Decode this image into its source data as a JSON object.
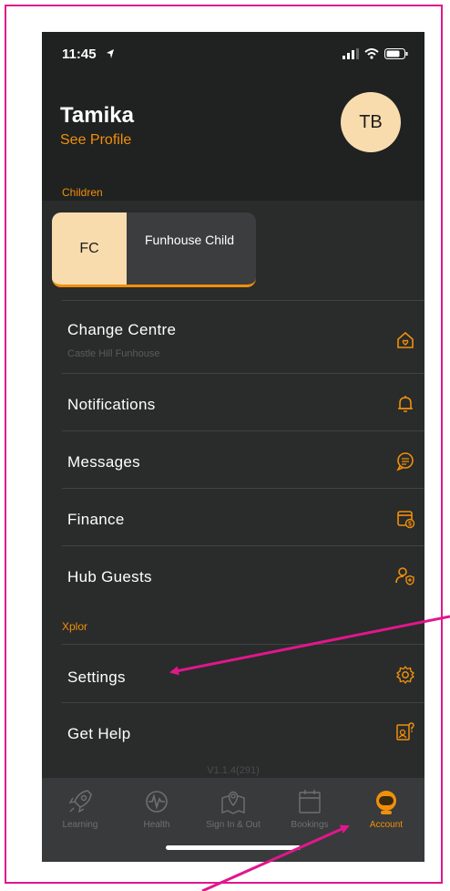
{
  "status_bar": {
    "time": "11:45"
  },
  "header": {
    "name": "Tamika",
    "see_profile": "See Profile",
    "avatar_initials": "TB"
  },
  "children_section": {
    "label": "Children",
    "child": {
      "initials": "FC",
      "name": "Funhouse Child"
    }
  },
  "menu": {
    "change_centre": {
      "label": "Change Centre",
      "sub": "Castle Hill Funhouse",
      "icon": "home-heart-icon"
    },
    "notifications": {
      "label": "Notifications",
      "icon": "bell-icon"
    },
    "messages": {
      "label": "Messages",
      "icon": "chat-icon"
    },
    "finance": {
      "label": "Finance",
      "icon": "wallet-dollar-icon"
    },
    "hub_guests": {
      "label": "Hub Guests",
      "icon": "user-shield-icon"
    },
    "xplor_section": "Xplor",
    "settings": {
      "label": "Settings",
      "icon": "gear-icon"
    },
    "get_help": {
      "label": "Get Help",
      "icon": "help-icon"
    }
  },
  "version": "V1.1.4(291)",
  "tabs": [
    {
      "label": "Learning",
      "icon": "rocket-icon"
    },
    {
      "label": "Health",
      "icon": "heartbeat-icon"
    },
    {
      "label": "Sign In & Out",
      "icon": "map-pin-icon"
    },
    {
      "label": "Bookings",
      "icon": "calendar-icon"
    },
    {
      "label": "Account",
      "icon": "astronaut-icon"
    }
  ],
  "colors": {
    "accent": "#f0900a",
    "annotation": "#e0178c",
    "avatar": "#f9dcae",
    "background": "#2a2b2b"
  }
}
